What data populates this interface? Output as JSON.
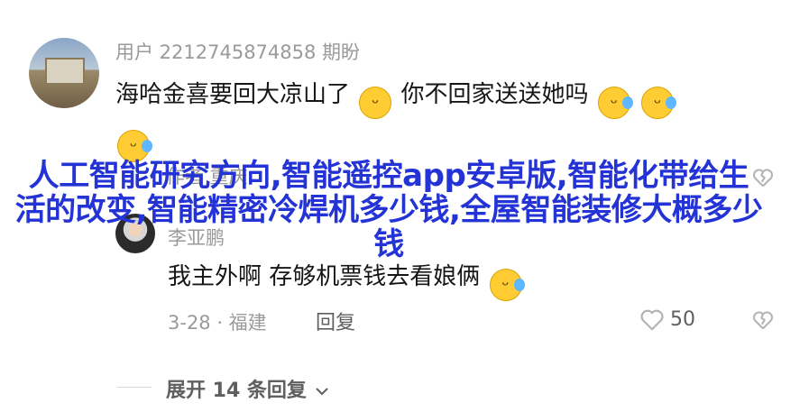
{
  "comment": {
    "username": "用户 2212745874858 期盼",
    "text_before": "海哈金喜要回大凉山了",
    "text_after": "你不回家送送她吗"
  },
  "overlay_text": "人工智能研究方向,智能遥控app安卓版,智能化带给生活的改变,智能精密冷焊机多少钱,全屋智能装修大概多少钱",
  "parent_meta": "作者 重庆",
  "reply": {
    "username": "李亚鹏",
    "text": "我主外啊 存够机票钱去看娘俩",
    "date": "3-28 · 福建",
    "reply_label": "回复",
    "likes": "50"
  },
  "expand": {
    "label": "展开 14 条回复"
  },
  "icons": {
    "grin": "grin-emoji-icon",
    "laugh_cry": "laugh-cry-emoji-icon",
    "heart": "heart-icon",
    "dislike": "broken-heart-icon",
    "chevron": "chevron-down-icon"
  },
  "colors": {
    "overlay": "#2433d6",
    "muted": "#9a9a9a"
  }
}
